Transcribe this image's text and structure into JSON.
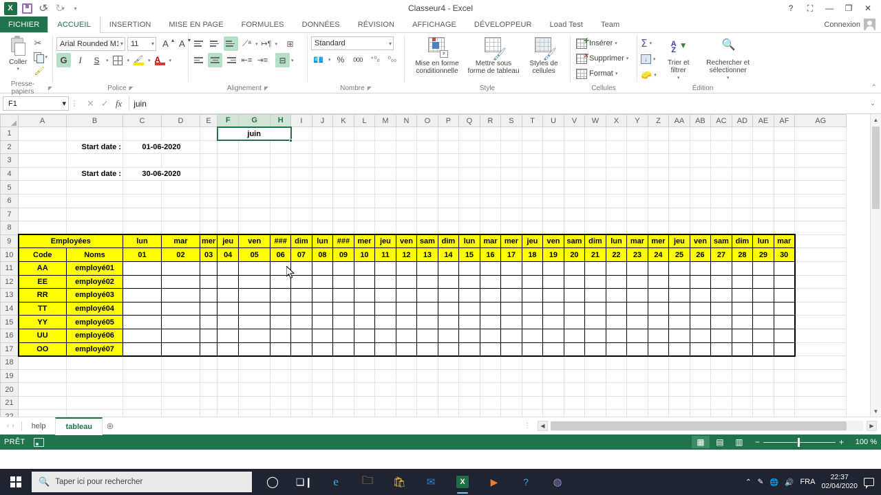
{
  "titlebar": {
    "app_icon": "excel-logo",
    "quick_access": [
      {
        "name": "save",
        "label": "Enregistrer"
      },
      {
        "name": "undo",
        "label": "Annuler"
      },
      {
        "name": "redo",
        "label": "Rétablir"
      },
      {
        "name": "customize",
        "label": "Personnaliser"
      }
    ],
    "title": "Classeur4 - Excel",
    "help_label": "?",
    "ribbon_display_label": "⛶",
    "minimize_label": "—",
    "restore_label": "❐",
    "close_label": "✕"
  },
  "ribbon": {
    "tabs": [
      {
        "label": "FICHIER",
        "active": false,
        "file": true
      },
      {
        "label": "ACCUEIL",
        "active": true
      },
      {
        "label": "INSERTION",
        "active": false
      },
      {
        "label": "MISE EN PAGE",
        "active": false
      },
      {
        "label": "FORMULES",
        "active": false
      },
      {
        "label": "DONNÉES",
        "active": false
      },
      {
        "label": "RÉVISION",
        "active": false
      },
      {
        "label": "AFFICHAGE",
        "active": false
      },
      {
        "label": "DÉVELOPPEUR",
        "active": false
      },
      {
        "label": "Load Test",
        "active": false
      },
      {
        "label": "Team",
        "active": false
      }
    ],
    "connexion_label": "Connexion",
    "collapse_label": "⌃",
    "groups": {
      "clipboard": {
        "label": "Presse-papiers",
        "paste_label": "Coller",
        "cut_label": "Couper",
        "copy_label": "Copier",
        "format_painter_label": "Reproduire la mise en forme"
      },
      "font": {
        "label": "Police",
        "font_name": "Arial Rounded M1",
        "font_size": "11",
        "grow_label": "A",
        "shrink_label": "A",
        "bold_label": "G",
        "italic_label": "I",
        "underline_label": "S",
        "borders_label": "Bordures",
        "fill_label": "Couleur de remplissage",
        "fontcolor_label": "A"
      },
      "alignment": {
        "label": "Alignement",
        "orientation_label": "Orientation",
        "wrap_label": "Renvoyer à la ligne",
        "merge_label": "Fusionner et centrer"
      },
      "number": {
        "label": "Nombre",
        "format": "Standard",
        "percent_label": "%",
        "thousands_label": "000",
        "inc_dec_label": "Ajouter une décimale",
        "dec_dec_label": "Réduire les décimales"
      },
      "style": {
        "label": "Style",
        "conditional_label": "Mise en forme conditionnelle",
        "table_label": "Mettre sous forme de tableau",
        "cellstyles_label": "Styles de cellules"
      },
      "cells": {
        "label": "Cellules",
        "insert_label": "Insérer",
        "delete_label": "Supprimer",
        "format_label": "Format"
      },
      "edition": {
        "label": "Édition",
        "sum_label": "Σ",
        "fill_label": "Remplissage",
        "clear_label": "Effacer",
        "sort_label": "Trier et filtrer",
        "find_label": "Rechercher et sélectionner"
      }
    }
  },
  "formula_bar": {
    "name_box": "F1",
    "cancel_label": "✕",
    "confirm_label": "✓",
    "fx_label": "fx",
    "formula_value": "juin",
    "expand_label": "⌄"
  },
  "grid": {
    "column_headers": [
      "A",
      "B",
      "C",
      "D",
      "E",
      "F",
      "G",
      "H",
      "I",
      "J",
      "K",
      "L",
      "M",
      "N",
      "O",
      "P",
      "Q",
      "R",
      "S",
      "T",
      "U",
      "V",
      "W",
      "X",
      "Y",
      "Z",
      "AA",
      "AB",
      "AC",
      "AD",
      "AE",
      "AF",
      "AG"
    ],
    "selected_columns": [
      "F",
      "G",
      "H"
    ],
    "row_headers": [
      "1",
      "2",
      "3",
      "4",
      "5",
      "6",
      "7",
      "8",
      "9",
      "10",
      "11",
      "12",
      "13",
      "14",
      "15",
      "16",
      "17",
      "18",
      "19",
      "20",
      "21",
      "22"
    ],
    "cells": {
      "merged_month": "juin",
      "start_date_label_1": "Start date :",
      "start_date_value_1": "01-06-2020",
      "start_date_label_2": "Start date :",
      "start_date_value_2": "30-06-2020"
    },
    "table": {
      "title_employees": "Employées",
      "header_code": "Code",
      "header_names": "Noms",
      "weekdays": [
        "lun",
        "mar",
        "mer",
        "jeu",
        "ven",
        "###",
        "dim",
        "lun",
        "###",
        "mer",
        "jeu",
        "ven",
        "sam",
        "dim",
        "lun",
        "mar",
        "mer",
        "jeu",
        "ven",
        "sam",
        "dim",
        "lun",
        "mar",
        "mer",
        "jeu",
        "ven",
        "sam",
        "dim",
        "lun",
        "mar"
      ],
      "daynumbers": [
        "01",
        "02",
        "03",
        "04",
        "05",
        "06",
        "07",
        "08",
        "09",
        "10",
        "11",
        "12",
        "13",
        "14",
        "15",
        "16",
        "17",
        "18",
        "19",
        "20",
        "21",
        "22",
        "23",
        "24",
        "25",
        "26",
        "27",
        "28",
        "29",
        "30"
      ],
      "rows": [
        {
          "code": "AA",
          "name": "employé01"
        },
        {
          "code": "EE",
          "name": "employé02"
        },
        {
          "code": "RR",
          "name": "employé03"
        },
        {
          "code": "TT",
          "name": "employé04"
        },
        {
          "code": "YY",
          "name": "employé05"
        },
        {
          "code": "UU",
          "name": "employé06"
        },
        {
          "code": "OO",
          "name": "employé07"
        }
      ]
    }
  },
  "sheet_tabs": {
    "prev_label": "‹",
    "next_label": "›",
    "tabs": [
      {
        "label": "help",
        "active": false
      },
      {
        "label": "tableau",
        "active": true
      }
    ],
    "add_label": "⊕"
  },
  "status_bar": {
    "state": "PRÊT",
    "macro_record_label": "Enregistrer une macro",
    "view_normal_label": "▦",
    "view_layout_label": "▤",
    "view_pagebreak_label": "▥",
    "zoom_out_label": "−",
    "zoom_in_label": "+",
    "zoom_level": "100 %"
  },
  "taskbar": {
    "start_label": "Démarrer",
    "search_placeholder": "Taper ici pour rechercher",
    "search_icon": "search-icon",
    "apps": [
      {
        "name": "cortana-icon",
        "glyph": "◯"
      },
      {
        "name": "task-view-icon",
        "glyph": "❒"
      },
      {
        "name": "edge-icon",
        "glyph": "e"
      },
      {
        "name": "file-explorer-icon",
        "glyph": "🗀"
      },
      {
        "name": "store-icon",
        "glyph": "🛍"
      },
      {
        "name": "mail-icon",
        "glyph": "✉"
      },
      {
        "name": "excel-icon",
        "glyph": "X"
      },
      {
        "name": "media-player-icon",
        "glyph": "▶"
      },
      {
        "name": "help-icon",
        "glyph": "?"
      },
      {
        "name": "browser-icon",
        "glyph": "◍"
      }
    ],
    "tray": {
      "chevron_label": "⌃",
      "pen_label": "✎",
      "network_label": "🌐",
      "volume_label": "🔊",
      "language": "FRA",
      "time": "22:37",
      "date": "02/04/2020",
      "notifications_label": "💬"
    }
  },
  "colors": {
    "excel_green": "#21734d",
    "accent_green": "#217346",
    "table_yellow": "#ffff00",
    "taskbar": "#1f2430"
  }
}
